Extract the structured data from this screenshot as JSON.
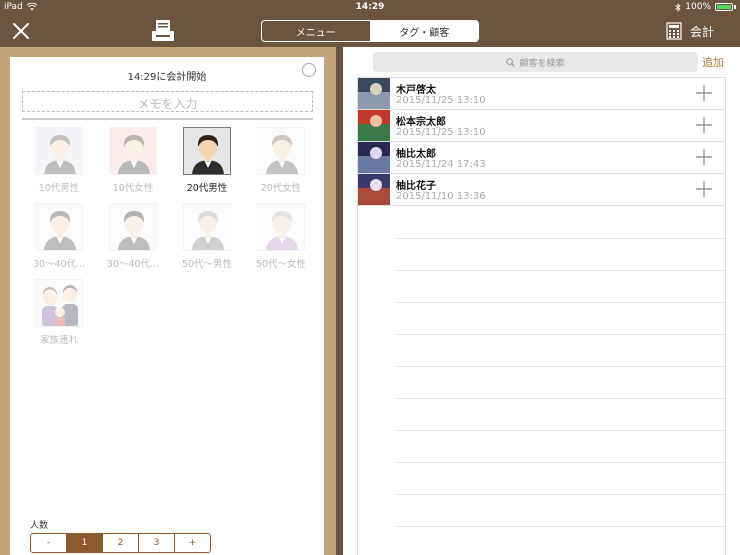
{
  "status": {
    "device": "iPad",
    "time": "14:29",
    "battery": "100%"
  },
  "nav": {
    "tab_menu": "メニュー",
    "tab_tag_customer": "タグ・顧客",
    "checkout_label": "会計"
  },
  "order": {
    "start_time": "14:29に会計開始",
    "memo_placeholder": "メモを入力"
  },
  "avatars": [
    {
      "label": "10代男性",
      "state": "dim"
    },
    {
      "label": "10代女性",
      "state": "dim"
    },
    {
      "label": "20代男性",
      "state": "selected"
    },
    {
      "label": "20代女性",
      "state": "dim"
    },
    {
      "label": "30～40代...",
      "state": "dim"
    },
    {
      "label": "30～40代...",
      "state": "dim"
    },
    {
      "label": "50代～男性",
      "state": "dim"
    },
    {
      "label": "50代～女性",
      "state": "dim"
    },
    {
      "label": "家族連れ",
      "state": "dim"
    }
  ],
  "people": {
    "label": "人数",
    "options": [
      "-",
      "1",
      "2",
      "3",
      "+"
    ],
    "selected": "1"
  },
  "customers": {
    "search_placeholder": "顧客を検索",
    "add_label": "追加",
    "items": [
      {
        "name": "木戸啓太",
        "date": "2015/11/25 13:10"
      },
      {
        "name": "松本宗太郎",
        "date": "2015/11/25 13:10"
      },
      {
        "name": "柚比太郎",
        "date": "2015/11/24 17:43"
      },
      {
        "name": "柚比花子",
        "date": "2015/11/10 13:36"
      }
    ]
  },
  "colors": {
    "nav_brown": "#6b5440",
    "panel_tan": "#c2a679",
    "accent_brown": "#8a5a2b",
    "link": "#b07a3c"
  }
}
